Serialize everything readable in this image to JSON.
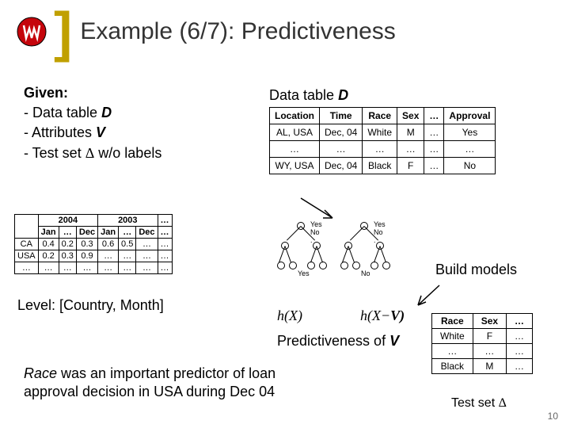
{
  "title": "Example (6/7): Predictiveness",
  "given": {
    "label": "Given:",
    "line1a": " - Data table ",
    "line1b": "D",
    "line2a": " - Attributes ",
    "line2b": "V",
    "line3a": " - Test set ",
    "line3b": "Δ",
    "line3c": " w/o labels"
  },
  "dtable": {
    "title_a": "Data table ",
    "title_b": "D",
    "headers": [
      "Location",
      "Time",
      "Race",
      "Sex",
      "…",
      "Approval"
    ],
    "rows": [
      [
        "AL, USA",
        "Dec, 04",
        "White",
        "M",
        "…",
        "Yes"
      ],
      [
        "…",
        "…",
        "…",
        "…",
        "…",
        "…"
      ],
      [
        "WY, USA",
        "Dec, 04",
        "Black",
        "F",
        "…",
        "No"
      ]
    ]
  },
  "ltable": {
    "year1": "2004",
    "year2": "2003",
    "dots": "…",
    "months": [
      "Jan",
      "…",
      "Dec",
      "Jan",
      "…",
      "Dec",
      "…"
    ],
    "rows": [
      [
        "CA",
        "0.4",
        "0.2",
        "0.3",
        "0.6",
        "0.5",
        "…",
        "…"
      ],
      [
        "USA",
        "0.2",
        "0.3",
        "0.9",
        "…",
        "…",
        "…",
        "…"
      ],
      [
        "…",
        "…",
        "…",
        "…",
        "…",
        "…",
        "…",
        "…"
      ]
    ],
    "level": "Level: [Country, Month]"
  },
  "tree": {
    "yes": "Yes",
    "no": "No",
    "dot": "."
  },
  "hx1": "h(X)",
  "hx2a": "h(X",
  "hx2b": "−",
  "hx2c": "V)",
  "build": "Build models",
  "pred_a": "Predictiveness of ",
  "pred_b": "V",
  "ttable": {
    "headers": [
      "Race",
      "Sex",
      "…"
    ],
    "rows": [
      [
        "White",
        "F",
        "…"
      ],
      [
        "…",
        "…",
        "…"
      ],
      [
        "Black",
        "M",
        "…"
      ]
    ]
  },
  "testset_a": "Test set ",
  "testset_b": "Δ",
  "conclusion_a": "Race",
  "conclusion_b": " was an important predictor of loan",
  "conclusion_c": "approval decision in USA during Dec 04",
  "pagenum": "10"
}
